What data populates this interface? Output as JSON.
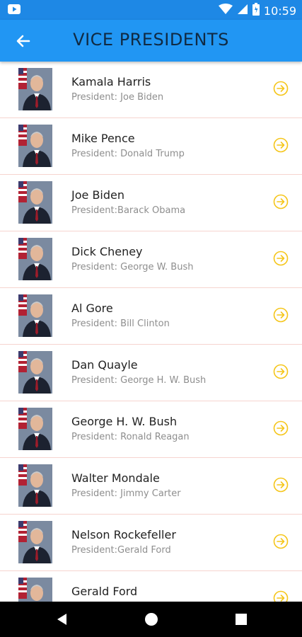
{
  "status_bar": {
    "time": "10:59"
  },
  "app_bar": {
    "title": "VICE PRESIDENTS"
  },
  "vice_presidents": [
    {
      "name": "Kamala Harris",
      "president": "President: Joe Biden"
    },
    {
      "name": "Mike Pence",
      "president": "President: Donald Trump"
    },
    {
      "name": "Joe Biden",
      "president": "President:Barack Obama"
    },
    {
      "name": "Dick Cheney",
      "president": "President: George W. Bush"
    },
    {
      "name": "Al Gore",
      "president": "President: Bill Clinton"
    },
    {
      "name": "Dan Quayle",
      "president": "President: George H. W. Bush"
    },
    {
      "name": "George H. W. Bush",
      "president": "President: Ronald Reagan"
    },
    {
      "name": "Walter Mondale",
      "president": "President: Jimmy Carter"
    },
    {
      "name": "Nelson Rockefeller",
      "president": "President:Gerald Ford"
    },
    {
      "name": "Gerald Ford",
      "president": ""
    }
  ],
  "colors": {
    "status_bar": "#1e88e5",
    "app_bar": "#2196f3",
    "title_text": "#102a43",
    "row_divider": "#f6d4cf",
    "arrow_icon": "#f5c518"
  }
}
